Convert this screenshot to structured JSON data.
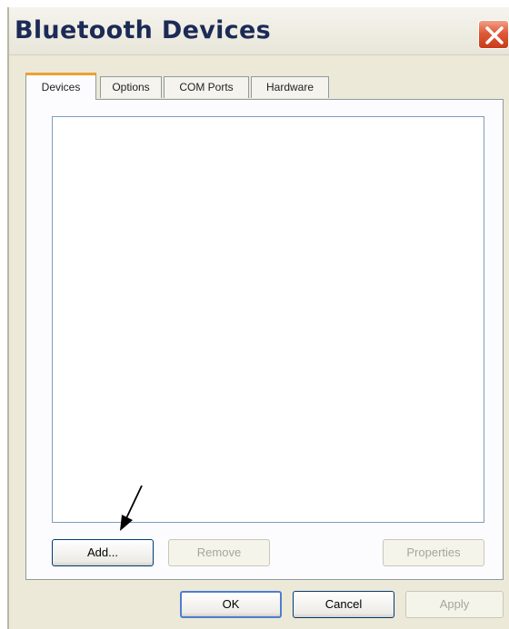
{
  "window": {
    "title": "Bluetooth Devices"
  },
  "tabs": [
    {
      "label": "Devices",
      "active": true
    },
    {
      "label": "Options",
      "active": false
    },
    {
      "label": "COM Ports",
      "active": false
    },
    {
      "label": "Hardware",
      "active": false
    }
  ],
  "devices_list": {
    "items": []
  },
  "panel_buttons": {
    "add": {
      "label": "Add...",
      "enabled": true
    },
    "remove": {
      "label": "Remove",
      "enabled": false
    },
    "properties": {
      "label": "Properties",
      "enabled": false
    }
  },
  "dialog_buttons": {
    "ok": {
      "label": "OK",
      "enabled": true
    },
    "cancel": {
      "label": "Cancel",
      "enabled": true
    },
    "apply": {
      "label": "Apply",
      "enabled": false
    }
  },
  "colors": {
    "active_tab_accent": "#f0a030",
    "close_button": "#e05a36",
    "title_text": "#1c2a56",
    "arrow_annotation": "#000000"
  },
  "icons": {
    "close": "close-icon"
  }
}
